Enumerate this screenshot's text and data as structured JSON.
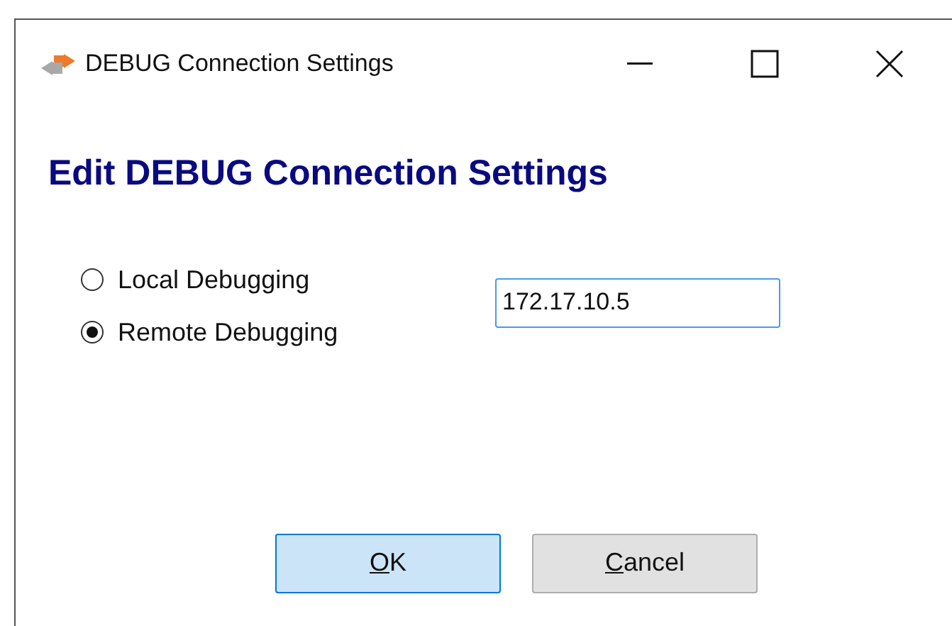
{
  "window": {
    "title": "DEBUG Connection Settings"
  },
  "heading": "Edit DEBUG Connection Settings",
  "modes": [
    {
      "label": "Local Debugging",
      "selected": false
    },
    {
      "label": "Remote Debugging",
      "selected": true
    }
  ],
  "address": {
    "value": "172.17.10.5"
  },
  "buttons": [
    {
      "label": "OK",
      "default": true,
      "mnemonic": true
    },
    {
      "label": "Cancel",
      "default": false,
      "mnemonic": true
    }
  ]
}
